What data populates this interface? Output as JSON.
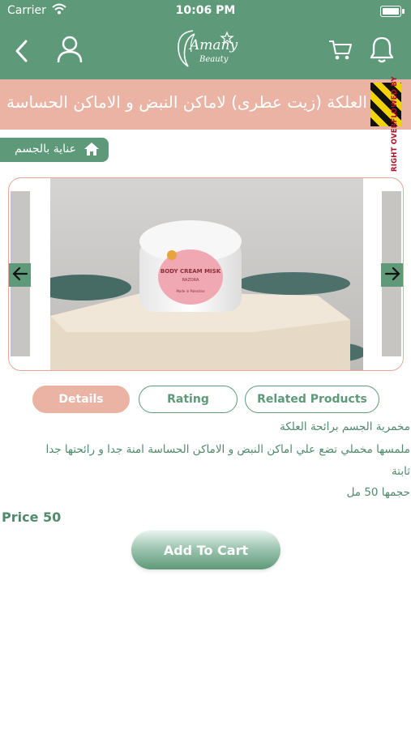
{
  "status_bar": {
    "carrier": "Carrier",
    "time": "10:06 PM"
  },
  "header": {
    "brand_name": "Amany",
    "brand_sub": "Beauty"
  },
  "product": {
    "title": "العلكة (زيت عطرى) لاماكن النبض و الاماكن الحساسة",
    "category": "عناية بالجسم",
    "jar_label": "BODY CREAM MISK",
    "jar_sublabel": "RAZORA",
    "jar_small": "Made in Palestine",
    "description": [
      "مخمرية الجسم برائحة العلكة",
      "ملمسها مخملي تضع علي اماكن النبض و الاماكن الحساسة امنة جدا و رائحتها جدا",
      "ثابتة",
      "حجمها 50 مل"
    ],
    "price": "Price 50"
  },
  "overflow_warning": "RIGHT OVERFLOWED BY",
  "tabs": [
    "Details",
    "Rating",
    "Related Products"
  ],
  "add_to_cart": "Add To Cart",
  "colors": {
    "primary": "#5e9a79",
    "accent": "#eab3a3"
  }
}
